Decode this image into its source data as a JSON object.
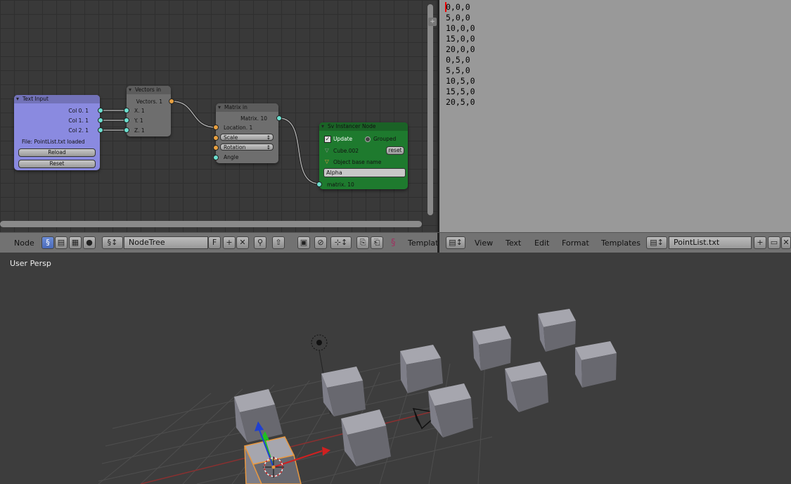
{
  "node_editor": {
    "nodes": {
      "text_input": {
        "title": "Text Input",
        "outputs": [
          "Col 0. 1",
          "Col 1. 1",
          "Col 2. 1"
        ],
        "file_status": "File: PointList.txt loaded",
        "reload_label": "Reload",
        "reset_label": "Reset",
        "color": "#8a8ae0"
      },
      "vectors_in": {
        "title": "Vectors in",
        "output": "Vectors. 1",
        "inputs": [
          "X. 1",
          "Y. 1",
          "Z. 1"
        ]
      },
      "matrix_in": {
        "title": "Matrix in",
        "output": "Matrix. 10",
        "location": "Location. 1",
        "scale": "Scale",
        "rotation": "Rotation",
        "angle": "Angle"
      },
      "instancer": {
        "title": "Sv Instancer Node",
        "update_label": "Update",
        "grouped_label": "Grouped",
        "object_name": "Cube.002",
        "reset_label": "reset",
        "base_name_label": "Object base name",
        "base_name_value": "Alpha",
        "input": "matrix. 10",
        "color": "#1e7a2e"
      }
    }
  },
  "node_header": {
    "menu_label": "Node",
    "tree_name": "NodeTree",
    "fake_user": "F",
    "templates_label": "Templates"
  },
  "text_editor": {
    "lines": [
      "0,0,0",
      "5,0,0",
      "10,0,0",
      "15,0,0",
      "20,0,0",
      "0,5,0",
      "5,5,0",
      "10,5,0",
      "15,5,0",
      "20,5,0"
    ],
    "menus": [
      "View",
      "Text",
      "Edit",
      "Format",
      "Templates"
    ],
    "filename": "PointList.txt"
  },
  "viewport": {
    "label": "User Persp"
  }
}
